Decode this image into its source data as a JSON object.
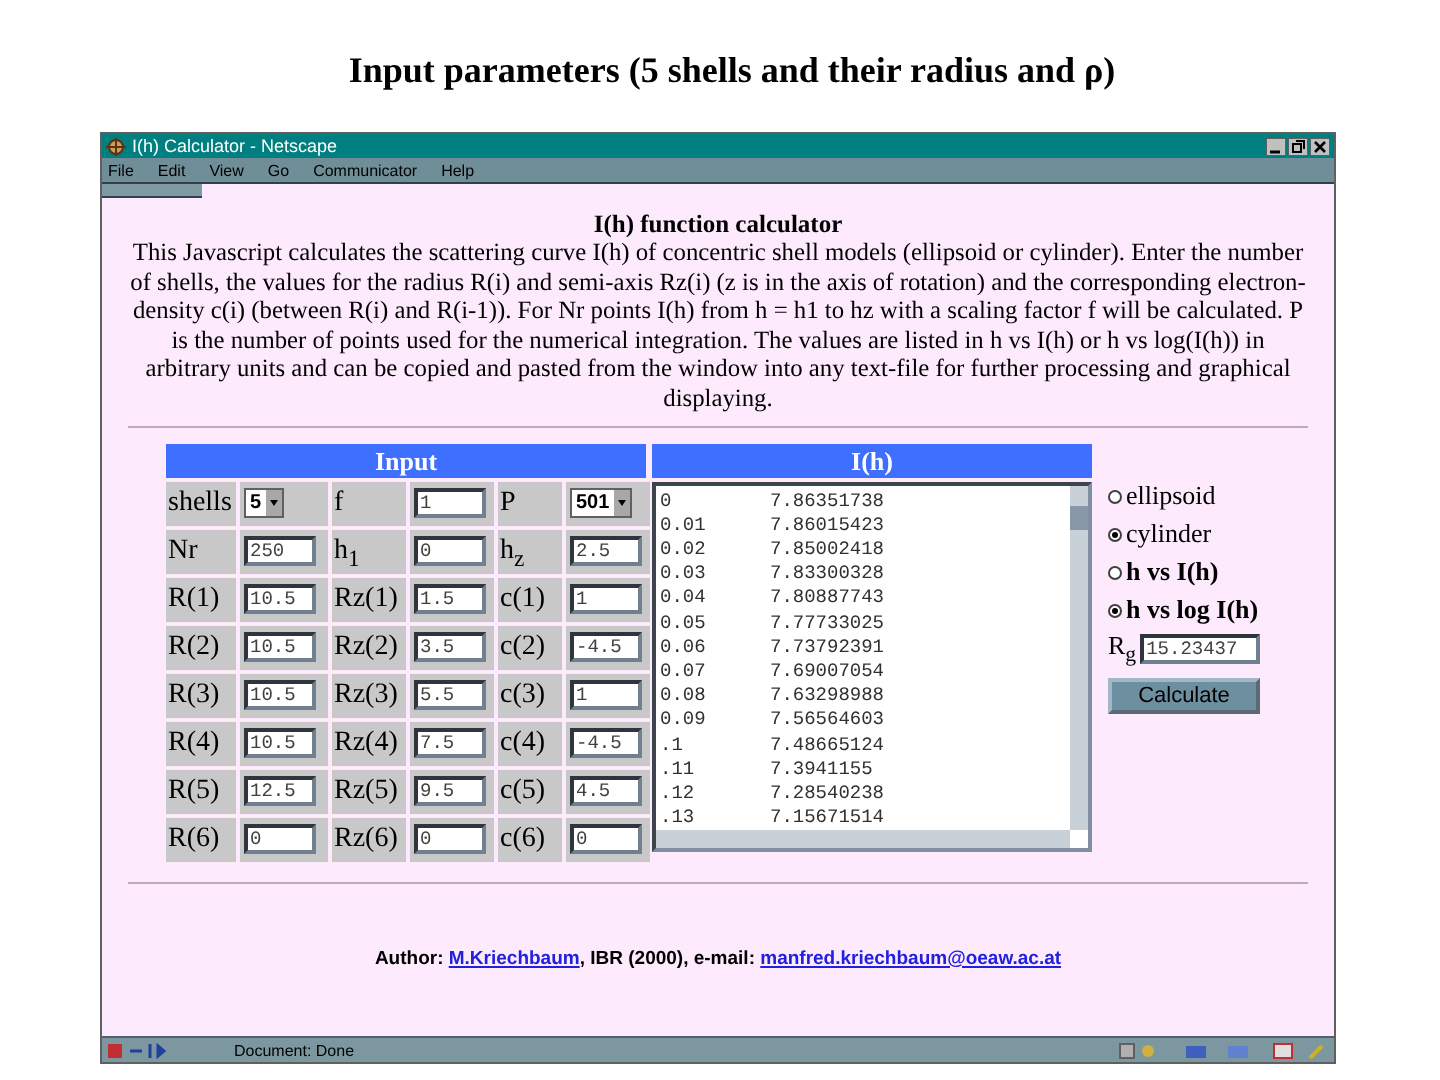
{
  "slide_title": "Input parameters (5 shells and their radius and ρ)",
  "window": {
    "title": "I(h) Calculator - Netscape",
    "menu": [
      "File",
      "Edit",
      "View",
      "Go",
      "Communicator",
      "Help"
    ]
  },
  "page": {
    "heading": "I(h) function calculator",
    "description": "This Javascript calculates the scattering curve I(h) of concentric shell models (ellipsoid or cylinder). Enter the number of shells, the values for the radius R(i) and semi-axis Rz(i) (z is in the axis of rotation) and the corresponding electron-density c(i) (between R(i) and R(i-1)). For Nr points I(h) from h = h1 to hz with a scaling factor f will be calculated. P is the number of points used for the numerical integration. The values are listed in h vs I(h) or h vs log(I(h)) in arbitrary units and can be copied and pasted from the window into any text-file for further processing and graphical displaying."
  },
  "input_panel": {
    "header": "Input",
    "rows": [
      [
        {
          "label": "shells",
          "kind": "select",
          "value": "5"
        },
        {
          "label": "f",
          "kind": "text",
          "value": "1"
        },
        {
          "label": "P",
          "kind": "select",
          "value": "501"
        }
      ],
      [
        {
          "label": "Nr",
          "kind": "text",
          "value": "250"
        },
        {
          "label": "h$_{1}$",
          "kind": "text",
          "value": "0"
        },
        {
          "label": "h$_{z}$",
          "kind": "text",
          "value": "2.5"
        }
      ],
      [
        {
          "label": "R(1)",
          "kind": "text",
          "value": "10.5"
        },
        {
          "label": "Rz(1)",
          "kind": "text",
          "value": "1.5"
        },
        {
          "label": "c(1)",
          "kind": "text",
          "value": "1"
        }
      ],
      [
        {
          "label": "R(2)",
          "kind": "text",
          "value": "10.5"
        },
        {
          "label": "Rz(2)",
          "kind": "text",
          "value": "3.5"
        },
        {
          "label": "c(2)",
          "kind": "text",
          "value": "-4.5"
        }
      ],
      [
        {
          "label": "R(3)",
          "kind": "text",
          "value": "10.5"
        },
        {
          "label": "Rz(3)",
          "kind": "text",
          "value": "5.5"
        },
        {
          "label": "c(3)",
          "kind": "text",
          "value": "1"
        }
      ],
      [
        {
          "label": "R(4)",
          "kind": "text",
          "value": "10.5"
        },
        {
          "label": "Rz(4)",
          "kind": "text",
          "value": "7.5"
        },
        {
          "label": "c(4)",
          "kind": "text",
          "value": "-4.5"
        }
      ],
      [
        {
          "label": "R(5)",
          "kind": "text",
          "value": "12.5"
        },
        {
          "label": "Rz(5)",
          "kind": "text",
          "value": "9.5"
        },
        {
          "label": "c(5)",
          "kind": "text",
          "value": "4.5"
        }
      ],
      [
        {
          "label": "R(6)",
          "kind": "text",
          "value": "0"
        },
        {
          "label": "Rz(6)",
          "kind": "text",
          "value": "0"
        },
        {
          "label": "c(6)",
          "kind": "text",
          "value": "0"
        }
      ]
    ]
  },
  "output_panel": {
    "header": "I(h)",
    "rows": [
      [
        "0",
        "7.86351738"
      ],
      [
        "0.01",
        "7.86015423"
      ],
      [
        "0.02",
        "7.85002418"
      ],
      [
        "0.03",
        "7.83300328"
      ],
      [
        "0.04",
        "7.80887743"
      ],
      [
        "0.05",
        "7.77733025"
      ],
      [
        "0.06",
        "7.73792391"
      ],
      [
        "0.07",
        "7.69007054"
      ],
      [
        "0.08",
        "7.63298988"
      ],
      [
        "0.09",
        "7.56564603"
      ],
      [
        ".1",
        "7.48665124"
      ],
      [
        ".11",
        "7.3941155"
      ],
      [
        ".12",
        "7.28540238"
      ],
      [
        ".13",
        "7.15671514"
      ]
    ]
  },
  "options": [
    {
      "label": "ellipsoid",
      "selected": false,
      "bold": false
    },
    {
      "label": "cylinder",
      "selected": true,
      "bold": false
    },
    {
      "label": "h vs I(h)",
      "selected": false,
      "bold": true
    },
    {
      "label": "h vs log I(h)",
      "selected": true,
      "bold": true
    }
  ],
  "rg": {
    "label": "R$_{g}$",
    "value": "15.23437"
  },
  "calculate_button": "Calculate",
  "footer": {
    "prefix": "Author: ",
    "author_link": "M.Kriechbaum",
    "middle": ", IBR (2000), e-mail: ",
    "email_link": "manfred.kriechbaum@oeaw.ac.at"
  },
  "status_bar": {
    "text": "Document: Done"
  }
}
